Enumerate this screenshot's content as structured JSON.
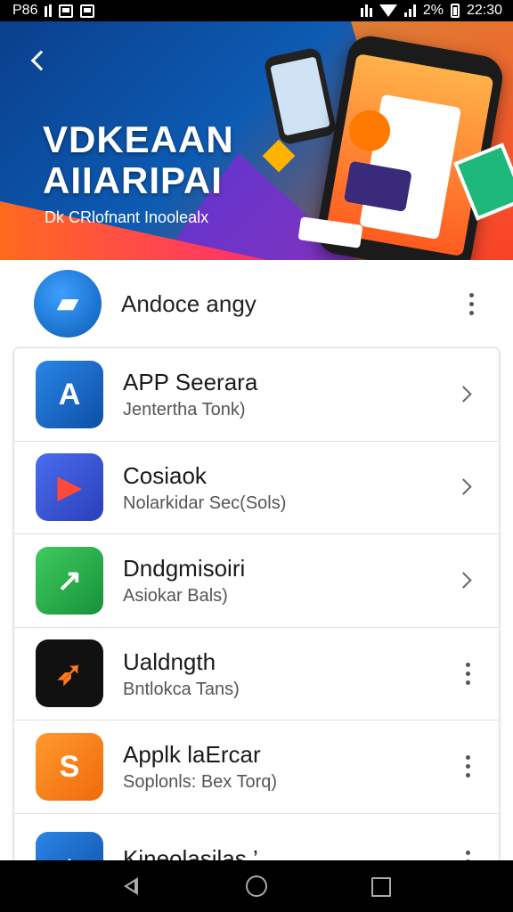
{
  "status_bar": {
    "left_text": "P86",
    "time": "22:30",
    "battery_text": "2%"
  },
  "banner": {
    "back_icon": "back-arrow-icon",
    "title_line1": "VDKEAAN",
    "title_line2": "AIIARIPAI",
    "subtitle": "Dk CRlofnant Inoolealx"
  },
  "header": {
    "title": "Andoce angy",
    "icon": "chat-bubble-icon",
    "icon_color": "#1a73c9",
    "menu_icon": "more-vert-icon"
  },
  "apps": [
    {
      "title": "APP Seerara",
      "subtitle": "Jentertha Tonk)",
      "icon": "app-store-icon",
      "icon_color": "#1e6fd0",
      "glyph": "A",
      "action": "chevron-right-icon"
    },
    {
      "title": "Cosiaok",
      "subtitle": "Nolarkidar Sec(Sols)",
      "icon": "arrow-play-icon",
      "icon_color": "#3558d6",
      "glyph": "▶",
      "action": "chevron-right-icon"
    },
    {
      "title": "Dndgmisoiri",
      "subtitle": "Asiokar Bals)",
      "icon": "trend-arrow-icon",
      "icon_color": "#22b14c",
      "glyph": "↗",
      "action": "chevron-right-icon"
    },
    {
      "title": "Ualdngth",
      "subtitle": "Bntlokca Tans)",
      "icon": "rocket-icon",
      "icon_color": "#111111",
      "glyph": "🚀",
      "action": "more-vert-icon"
    },
    {
      "title": "Applk laErcar",
      "subtitle": "Soplonls: Bex Torq)",
      "icon": "sync-icon",
      "icon_color": "#ff7a1a",
      "glyph": "S",
      "action": "more-vert-icon"
    },
    {
      "title": "Kineolasilas ’",
      "subtitle": "",
      "icon": "shield-icon",
      "icon_color": "#1e6fd0",
      "glyph": "⌂",
      "action": "more-vert-icon"
    }
  ],
  "nav": {
    "back_icon": "nav-back-icon",
    "home_icon": "nav-home-icon",
    "recent_icon": "nav-recent-icon"
  }
}
